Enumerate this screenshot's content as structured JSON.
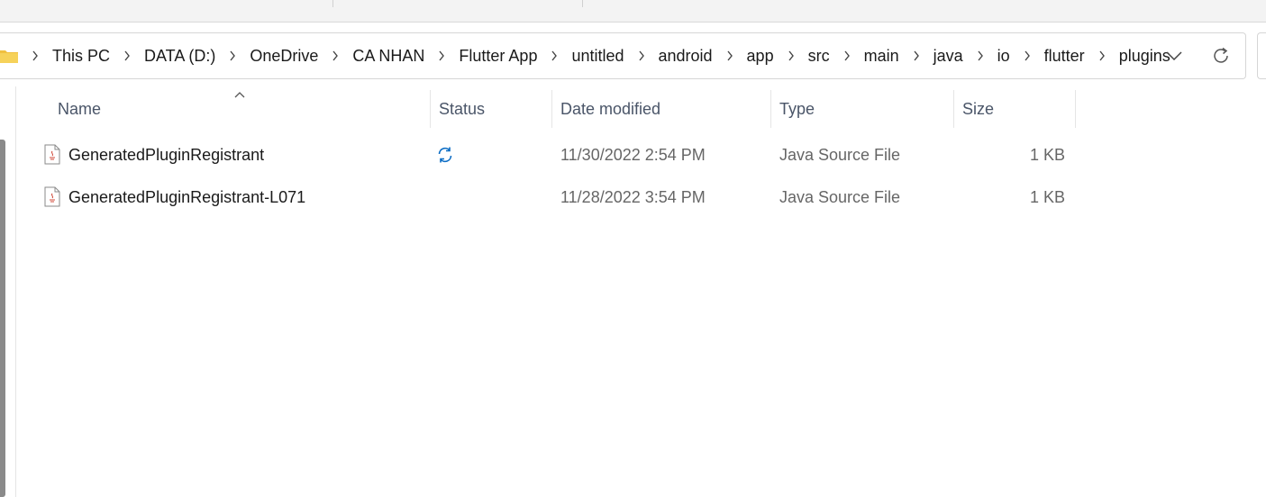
{
  "breadcrumb": {
    "items": [
      "This PC",
      "DATA (D:)",
      "OneDrive",
      "CA NHAN",
      "Flutter App",
      "untitled",
      "android",
      "app",
      "src",
      "main",
      "java",
      "io",
      "flutter",
      "plugins"
    ]
  },
  "columns": {
    "name": "Name",
    "status": "Status",
    "date_modified": "Date modified",
    "type": "Type",
    "size": "Size"
  },
  "files": [
    {
      "name": "GeneratedPluginRegistrant",
      "status_icon": "sync-icon",
      "date_modified": "11/30/2022 2:54 PM",
      "type": "Java Source File",
      "size": "1 KB"
    },
    {
      "name": "GeneratedPluginRegistrant-L071",
      "status_icon": "",
      "date_modified": "11/28/2022 3:54 PM",
      "type": "Java Source File",
      "size": "1 KB"
    }
  ],
  "colors": {
    "accent": "#0a6cc4",
    "header_text": "#4a5568",
    "secondary_text": "#666666",
    "folder_yellow": "#f0c040",
    "java_red": "#d04a3a"
  }
}
